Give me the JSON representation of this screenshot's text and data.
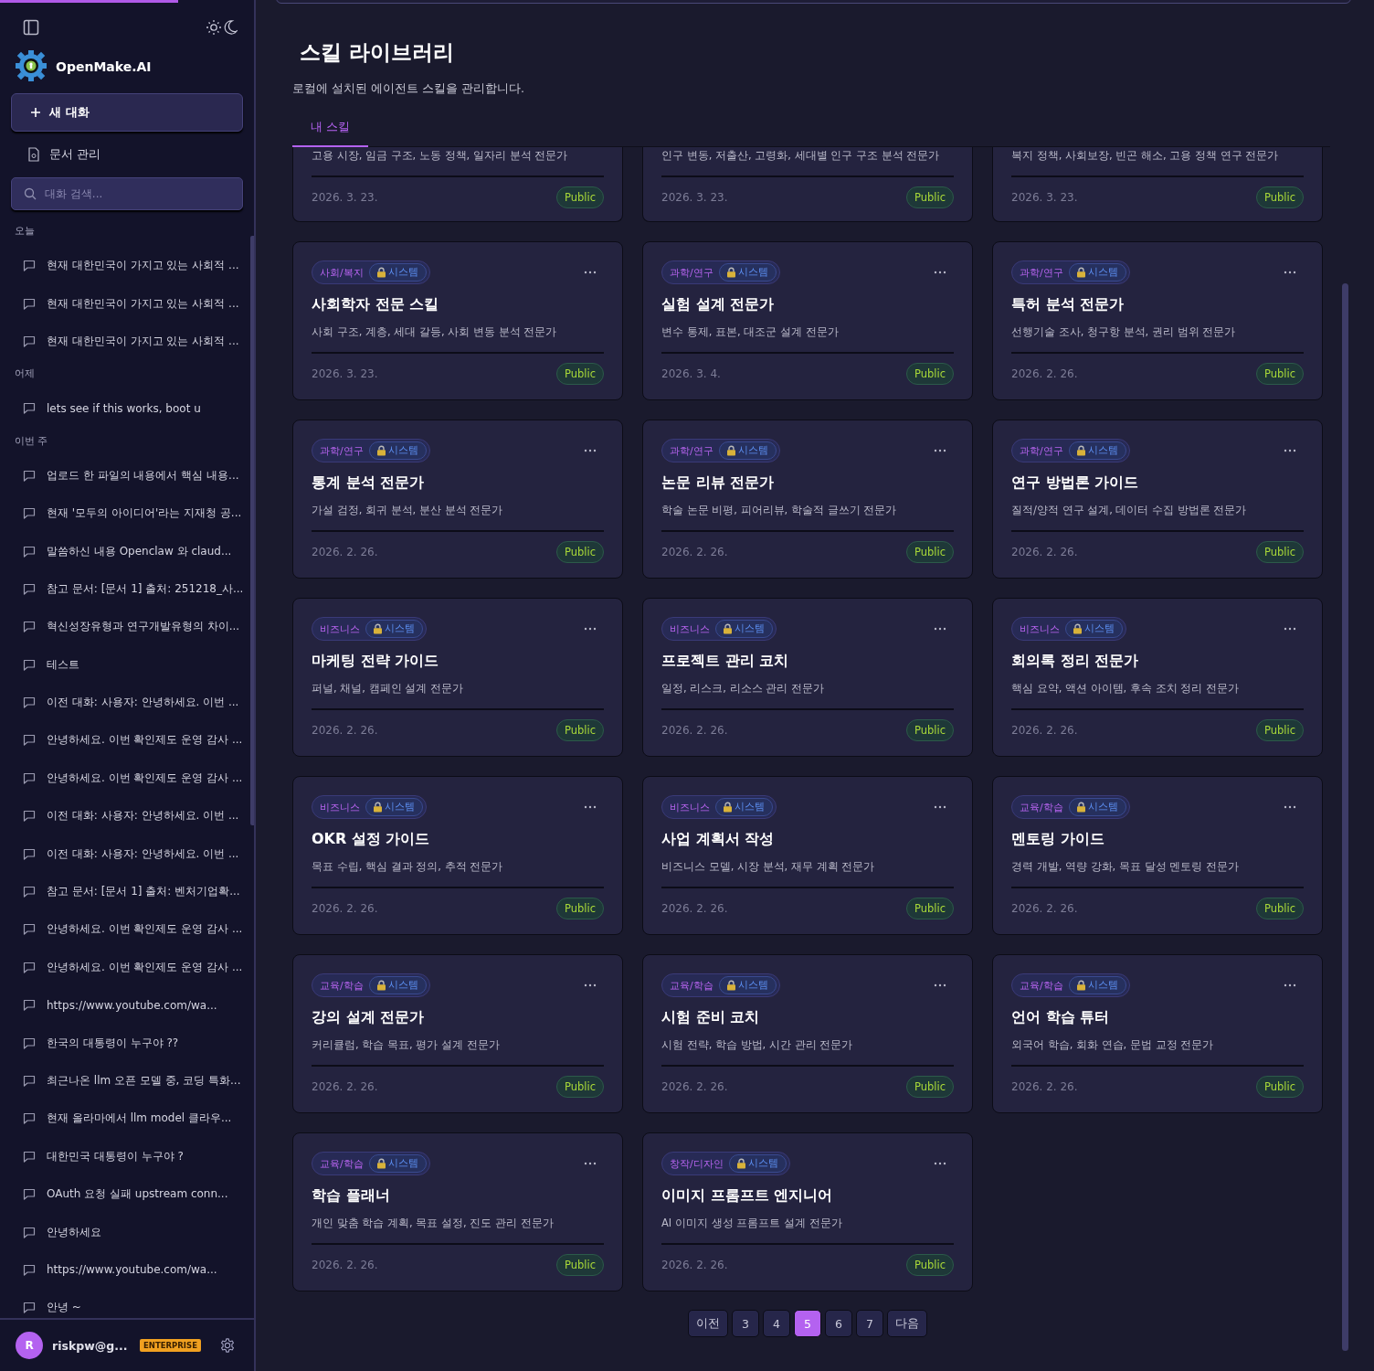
{
  "sidebar": {
    "brand": "OpenMake.AI",
    "new_chat": "새 대화",
    "docs": "문서 관리",
    "search": {
      "placeholder": "대화 검색..."
    },
    "groups": [
      {
        "label": "오늘",
        "items": [
          "현재 대한민국이 가지고 있는 사회적 ...",
          "현재 대한민국이 가지고 있는 사회적 ...",
          "현재 대한민국이 가지고 있는 사회적 ..."
        ]
      },
      {
        "label": "어제",
        "items": [
          "lets see if this works, boot u"
        ]
      },
      {
        "label": "이번 주",
        "items": [
          "업로드 한 파일의 내용에서 핵심 내용...",
          "현재 '모두의 아이디어'라는 지재청 공...",
          "말씀하신 내용 Openclaw 와 claud...",
          "참고 문서: [문서 1] 출처: 251218_사...",
          "혁신성장유형과 연구개발유형의 차이...",
          "테스트",
          "이전 대화: 사용자: 안녕하세요. 이번 ...",
          "안녕하세요. 이번 확인제도 운영 감사 ...",
          "안녕하세요. 이번 확인제도 운영 감사 ...",
          "이전 대화: 사용자: 안녕하세요. 이번 ...",
          "이전 대화: 사용자: 안녕하세요. 이번 ...",
          "참고 문서: [문서 1] 출처: 벤처기업확...",
          "안녕하세요. 이번 확인제도 운영 감사 ...",
          "안녕하세요. 이번 확인제도 운영 감사 ...",
          "https://www.youtube.com/wa...",
          "한국의 대통령이 누구야 ??",
          "최근나온 llm 오픈 모델 중, 코딩 특화...",
          "현재 올라마에서 llm model 클라우...",
          "대한민국 대통령이 누구야 ?",
          "OAuth 요청 실패 upstream conn...",
          "안녕하세요",
          "https://www.youtube.com/wa...",
          "안녕 ~"
        ]
      }
    ],
    "user": {
      "initial": "R",
      "name": "riskpw@g...",
      "plan": "ENTERPRISE"
    }
  },
  "main": {
    "title": "스킬 라이브러리",
    "subtitle": "로컬에 설치된 에이전트 스킬을 관리합니다.",
    "tabs": [
      {
        "label": "내 스킬",
        "selected": true
      }
    ],
    "cards": [
      {
        "kind": "partial",
        "description": "고용 시장, 임금 구조, 노동 정책, 일자리 분석 전문가",
        "date": "2026. 3. 23.",
        "visibility": "Public"
      },
      {
        "kind": "partial",
        "description": "인구 변동, 저출산, 고령화, 세대별 인구 구조 분석 전문가",
        "date": "2026. 3. 23.",
        "visibility": "Public"
      },
      {
        "kind": "partial",
        "description": "복지 정책, 사회보장, 빈곤 해소, 고용 정책 연구 전문가",
        "date": "2026. 3. 23.",
        "visibility": "Public"
      },
      {
        "kind": "full",
        "category": "사회/복지",
        "system": "시스템",
        "title": "사회학자 전문 스킬",
        "description": "사회 구조, 계층, 세대 갈등, 사회 변동 분석 전문가",
        "date": "2026. 3. 23.",
        "visibility": "Public"
      },
      {
        "kind": "full",
        "category": "과학/연구",
        "system": "시스템",
        "title": "실험 설계 전문가",
        "description": "변수 통제, 표본, 대조군 설계 전문가",
        "date": "2026. 3. 4.",
        "visibility": "Public"
      },
      {
        "kind": "full",
        "category": "과학/연구",
        "system": "시스템",
        "title": "특허 분석 전문가",
        "description": "선행기술 조사, 청구항 분석, 권리 범위 전문가",
        "date": "2026. 2. 26.",
        "visibility": "Public"
      },
      {
        "kind": "full",
        "category": "과학/연구",
        "system": "시스템",
        "title": "통계 분석 전문가",
        "description": "가설 검정, 회귀 분석, 분산 분석 전문가",
        "date": "2026. 2. 26.",
        "visibility": "Public"
      },
      {
        "kind": "full",
        "category": "과학/연구",
        "system": "시스템",
        "title": "논문 리뷰 전문가",
        "description": "학술 논문 비평, 피어리뷰, 학술적 글쓰기 전문가",
        "date": "2026. 2. 26.",
        "visibility": "Public"
      },
      {
        "kind": "full",
        "category": "과학/연구",
        "system": "시스템",
        "title": "연구 방법론 가이드",
        "description": "질적/양적 연구 설계, 데이터 수집 방법론 전문가",
        "date": "2026. 2. 26.",
        "visibility": "Public"
      },
      {
        "kind": "full",
        "category": "비즈니스",
        "system": "시스템",
        "title": "마케팅 전략 가이드",
        "description": "퍼널, 채널, 캠페인 설계 전문가",
        "date": "2026. 2. 26.",
        "visibility": "Public"
      },
      {
        "kind": "full",
        "category": "비즈니스",
        "system": "시스템",
        "title": "프로젝트 관리 코치",
        "description": "일정, 리스크, 리소스 관리 전문가",
        "date": "2026. 2. 26.",
        "visibility": "Public"
      },
      {
        "kind": "full",
        "category": "비즈니스",
        "system": "시스템",
        "title": "회의록 정리 전문가",
        "description": "핵심 요약, 액션 아이템, 후속 조치 정리 전문가",
        "date": "2026. 2. 26.",
        "visibility": "Public"
      },
      {
        "kind": "full",
        "category": "비즈니스",
        "system": "시스템",
        "title": "OKR 설정 가이드",
        "description": "목표 수립, 핵심 결과 정의, 추적 전문가",
        "date": "2026. 2. 26.",
        "visibility": "Public"
      },
      {
        "kind": "full",
        "category": "비즈니스",
        "system": "시스템",
        "title": "사업 계획서 작성",
        "description": "비즈니스 모델, 시장 분석, 재무 계획 전문가",
        "date": "2026. 2. 26.",
        "visibility": "Public"
      },
      {
        "kind": "full",
        "category": "교육/학습",
        "system": "시스템",
        "title": "멘토링 가이드",
        "description": "경력 개발, 역량 강화, 목표 달성 멘토링 전문가",
        "date": "2026. 2. 26.",
        "visibility": "Public"
      },
      {
        "kind": "full",
        "category": "교육/학습",
        "system": "시스템",
        "title": "강의 설계 전문가",
        "description": "커리큘럼, 학습 목표, 평가 설계 전문가",
        "date": "2026. 2. 26.",
        "visibility": "Public"
      },
      {
        "kind": "full",
        "category": "교육/학습",
        "system": "시스템",
        "title": "시험 준비 코치",
        "description": "시험 전략, 학습 방법, 시간 관리 전문가",
        "date": "2026. 2. 26.",
        "visibility": "Public"
      },
      {
        "kind": "full",
        "category": "교육/학습",
        "system": "시스템",
        "title": "언어 학습 튜터",
        "description": "외국어 학습, 회화 연습, 문법 교정 전문가",
        "date": "2026. 2. 26.",
        "visibility": "Public"
      },
      {
        "kind": "full",
        "category": "교육/학습",
        "system": "시스템",
        "title": "학습 플래너",
        "description": "개인 맞춤 학습 계획, 목표 설정, 진도 관리 전문가",
        "date": "2026. 2. 26.",
        "visibility": "Public"
      },
      {
        "kind": "full",
        "category": "창작/디자인",
        "system": "시스템",
        "title": "이미지 프롬프트 엔지니어",
        "description": "AI 이미지 생성 프롬프트 설계 전문가",
        "date": "2026. 2. 26.",
        "visibility": "Public"
      }
    ],
    "pagination": [
      {
        "label": "이전",
        "selected": false
      },
      {
        "label": "3",
        "selected": false
      },
      {
        "label": "4",
        "selected": false
      },
      {
        "label": "5",
        "selected": true
      },
      {
        "label": "6",
        "selected": false
      },
      {
        "label": "7",
        "selected": false
      },
      {
        "label": "다음",
        "selected": false
      }
    ]
  }
}
